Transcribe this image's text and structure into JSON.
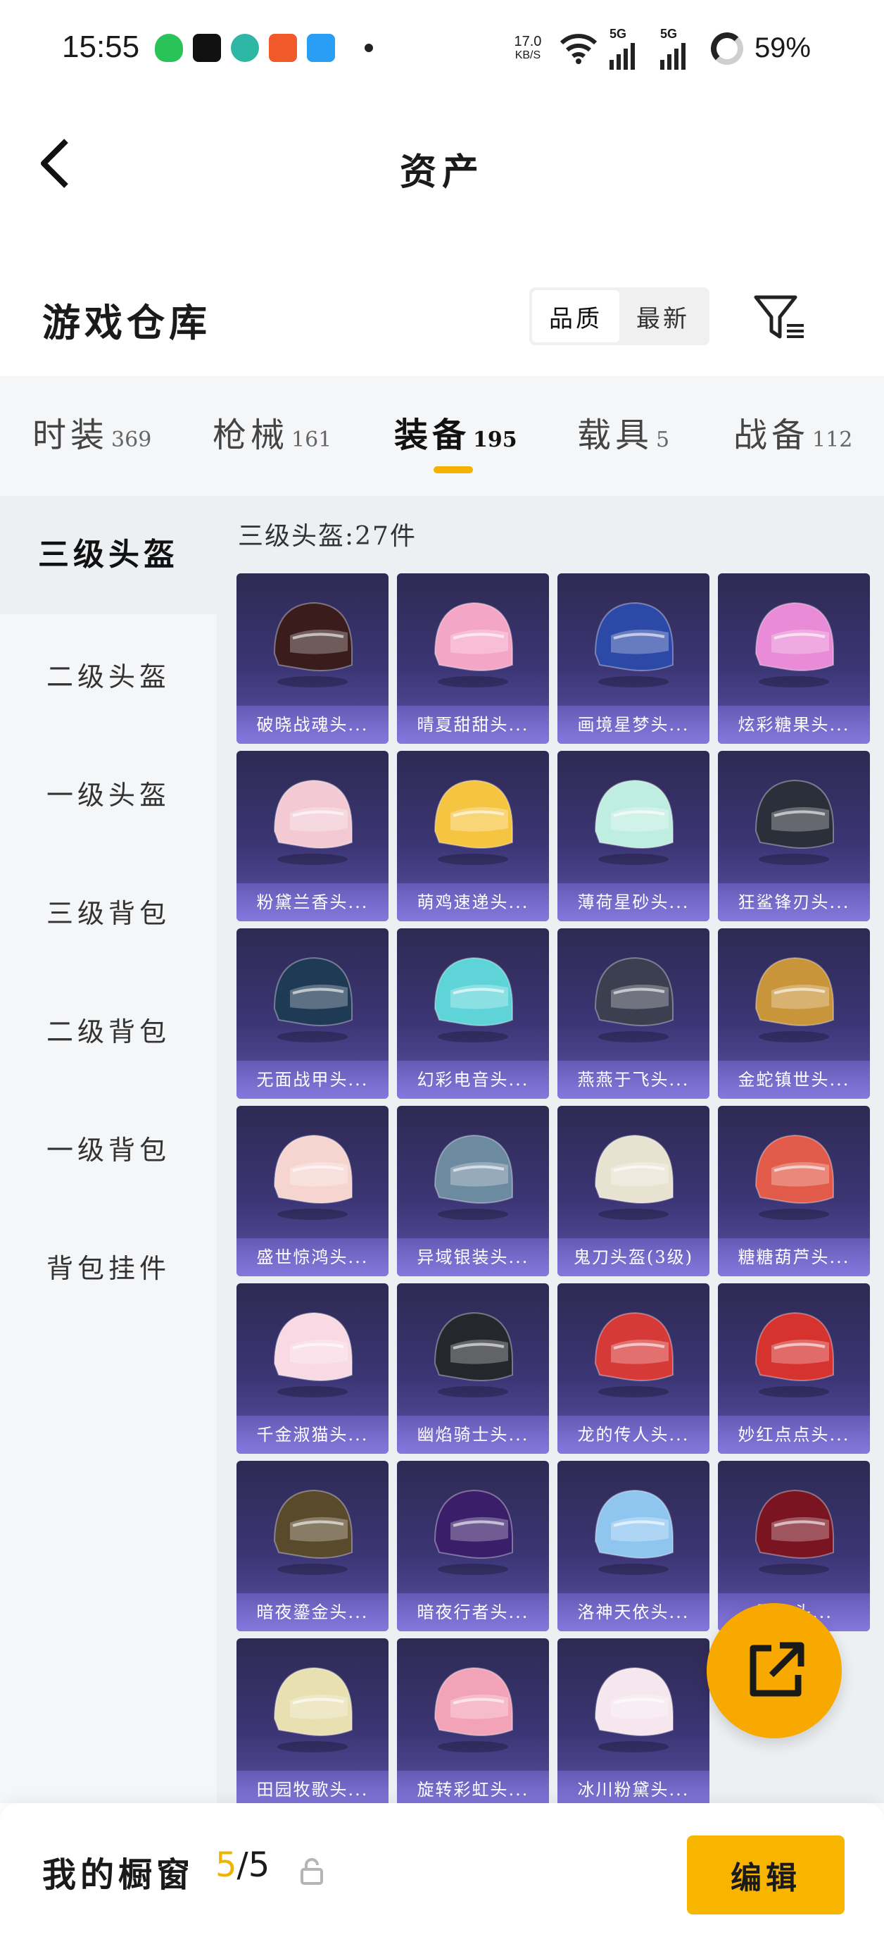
{
  "status_bar": {
    "time": "15:55",
    "speed_value": "17.0",
    "speed_unit": "KB/S",
    "network_1": "5G",
    "network_2": "5G",
    "battery": "59%"
  },
  "header": {
    "title": "资产",
    "back_icon": "chevron-left-icon"
  },
  "warehouse": {
    "title": "游戏仓库",
    "sort_options": [
      "品质",
      "最新"
    ],
    "active_sort": "品质",
    "filter_icon": "filter-icon"
  },
  "tabs": [
    {
      "name": "时装",
      "count": "369"
    },
    {
      "name": "枪械",
      "count": "161"
    },
    {
      "name": "装备",
      "count": "195"
    },
    {
      "name": "载具",
      "count": "5"
    },
    {
      "name": "战备",
      "count": "112"
    }
  ],
  "active_tab": "装备",
  "sidebar": {
    "items": [
      "三级头盔",
      "二级头盔",
      "一级头盔",
      "三级背包",
      "二级背包",
      "一级背包",
      "背包挂件"
    ],
    "active": "三级头盔"
  },
  "content": {
    "section_title": "三级头盔:27件",
    "items": [
      {
        "label": "破晓战魂头...",
        "color": "#3a1c1c"
      },
      {
        "label": "晴夏甜甜头...",
        "color": "#f4a6c6"
      },
      {
        "label": "画境星梦头...",
        "color": "#2d49a8"
      },
      {
        "label": "炫彩糖果头...",
        "color": "#e98bd6"
      },
      {
        "label": "粉黛兰香头...",
        "color": "#f3c9d4"
      },
      {
        "label": "萌鸡速递头...",
        "color": "#f5c542"
      },
      {
        "label": "薄荷星砂头...",
        "color": "#bfeee0"
      },
      {
        "label": "狂鲨锋刃头...",
        "color": "#2b2f3a"
      },
      {
        "label": "无面战甲头...",
        "color": "#1f3a55"
      },
      {
        "label": "幻彩电音头...",
        "color": "#5fd4d8"
      },
      {
        "label": "燕燕于飞头...",
        "color": "#3b3f4f"
      },
      {
        "label": "金蛇镇世头...",
        "color": "#c9953a"
      },
      {
        "label": "盛世惊鸿头...",
        "color": "#f6d5d0"
      },
      {
        "label": "异域银装头...",
        "color": "#6c8aa0"
      },
      {
        "label": "鬼刀头盔(3级)",
        "color": "#e8e2d0"
      },
      {
        "label": "糖糖葫芦头...",
        "color": "#e25a4a"
      },
      {
        "label": "千金淑猫头...",
        "color": "#f8d9e4"
      },
      {
        "label": "幽焰骑士头...",
        "color": "#24282c"
      },
      {
        "label": "龙的传人头...",
        "color": "#d63a38"
      },
      {
        "label": "妙红点点头...",
        "color": "#d6322e"
      },
      {
        "label": "暗夜鎏金头...",
        "color": "#5a4a2c"
      },
      {
        "label": "暗夜行者头...",
        "color": "#3a1e6a"
      },
      {
        "label": "洛神天依头...",
        "color": "#8fc6f0"
      },
      {
        "label": "星...头...",
        "color": "#7a1420"
      },
      {
        "label": "田园牧歌头...",
        "color": "#e8e0b0"
      },
      {
        "label": "旋转彩虹头...",
        "color": "#f3a3b8"
      },
      {
        "label": "冰川粉黛头...",
        "color": "#f6e6ee"
      }
    ]
  },
  "fab_icon": "external-link-icon",
  "bottom": {
    "showcase_label": "我的橱窗",
    "used": "5",
    "separator": "/",
    "total": "5",
    "lock_icon": "lock-icon",
    "edit_label": "编辑"
  },
  "colors": {
    "accent": "#f7b500",
    "card_bg": "#3b3574",
    "tab_bar_bg": "#f4f6f8"
  }
}
